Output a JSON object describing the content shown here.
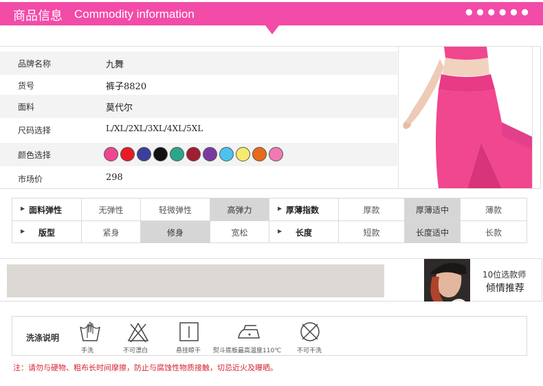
{
  "header": {
    "title_cn": "商品信息",
    "title_en": "Commodity information",
    "dots": "● ● ● ● ● ●",
    "color": "#f34ba8"
  },
  "info": {
    "rows": [
      {
        "label": "品牌名称",
        "value": "九舞"
      },
      {
        "label": "货号",
        "value": "裤子8820"
      },
      {
        "label": "面料",
        "value": "莫代尔"
      },
      {
        "label": "尺码选择",
        "value": "L/XL/2XL/3XL/4XL/5XL"
      },
      {
        "label": "颜色选择",
        "value": ""
      },
      {
        "label": "市场价",
        "value": "298"
      }
    ],
    "colors": [
      "#f0468f",
      "#e81b24",
      "#3b3f9c",
      "#111111",
      "#2aa78a",
      "#a01e34",
      "#7b3aa2",
      "#4cc2ee",
      "#f7ea6e",
      "#e86a1c",
      "#f07ab4"
    ]
  },
  "props": {
    "row1": {
      "head_a": "面料弹性",
      "opts_a": [
        "无弹性",
        "轻微弹性",
        "高弹力"
      ],
      "head_b": "厚薄指数",
      "opts_b": [
        "厚款",
        "厚薄适中",
        "薄款"
      ]
    },
    "row2": {
      "head_a": "版型",
      "opts_a": [
        "紧身",
        "修身",
        "宽松"
      ],
      "head_b": "长度",
      "opts_b": [
        "短款",
        "长度适中",
        "长款"
      ]
    }
  },
  "banner": {
    "line1": "10位选款师",
    "line2": "倾情推荐"
  },
  "wash": {
    "label": "洗涤说明",
    "icons": [
      {
        "icon": "hand-wash-icon",
        "caption": "手洗"
      },
      {
        "icon": "no-bleach-icon",
        "caption": "不可漂白"
      },
      {
        "icon": "hang-dry-icon",
        "caption": "悬挂晾干"
      },
      {
        "icon": "iron-icon",
        "caption": "熨斗底板最高温度110℃"
      },
      {
        "icon": "no-dry-clean-icon",
        "caption": "不可干洗"
      }
    ]
  },
  "note": "注：请勿与硬物、粗布长时间摩擦，防止与腐蚀性物质接触，切忌近火及曝晒。"
}
